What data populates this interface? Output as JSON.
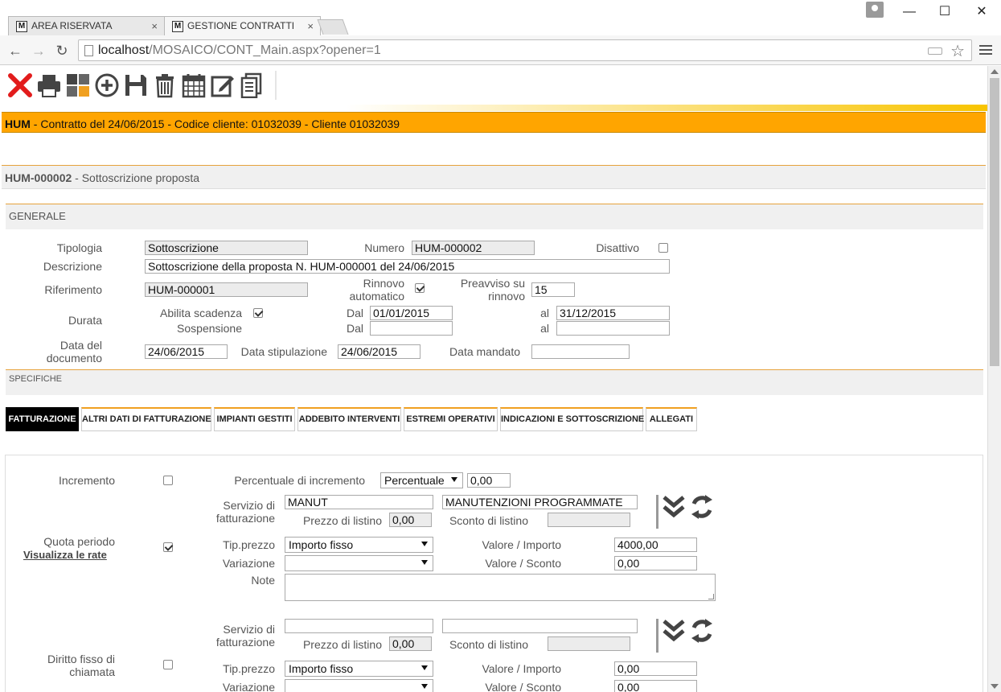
{
  "browser": {
    "tabs": [
      {
        "label": "AREA RISERVATA"
      },
      {
        "label": "GESTIONE CONTRATTI"
      }
    ],
    "url_host": "localhost",
    "url_path": "/MOSAICO/CONT_Main.aspx?opener=1",
    "tab_close": "×",
    "min": "—",
    "max": "☐",
    "close": "✕"
  },
  "toolbar": {
    "icons": [
      "close-icon",
      "print-icon",
      "puzzle-icon",
      "add-icon",
      "save-icon",
      "delete-icon",
      "calendar-icon",
      "edit-icon",
      "copy-icon"
    ]
  },
  "header": {
    "code": "HUM",
    "text": " - Contratto del 24/06/2015 - Codice cliente: 01032039 - Cliente 01032039"
  },
  "document": {
    "code": "HUM-000002",
    "text": " - Sottoscrizione proposta"
  },
  "generale": {
    "title": "GENERALE",
    "tipologia_label": "Tipologia",
    "tipologia": "Sottoscrizione",
    "numero_label": "Numero",
    "numero": "HUM-000002",
    "disattivo_label": "Disattivo",
    "descrizione_label": "Descrizione",
    "descrizione": "Sottoscrizione della proposta N. HUM-000001 del 24/06/2015",
    "riferimento_label": "Riferimento",
    "riferimento": "HUM-000001",
    "rinnovo_label_1": "Rinnovo",
    "rinnovo_label_2": "automatico",
    "preavviso_label_1": "Preavviso su",
    "preavviso_label_2": "rinnovo",
    "preavviso": "15",
    "durata_label": "Durata",
    "abilita_label": "Abilita scadenza",
    "sospensione_label": "Sospensione",
    "dal_label": "Dal",
    "al_label": "al",
    "dal1": "01/01/2015",
    "al1": "31/12/2015",
    "dal2": "",
    "al2": "",
    "data_doc_label_1": "Data del",
    "data_doc_label_2": "documento",
    "data_doc": "24/06/2015",
    "data_stip_label": "Data stipulazione",
    "data_stip": "24/06/2015",
    "data_mandato_label": "Data mandato",
    "data_mandato": ""
  },
  "specifiche": {
    "title": "SPECIFICHE",
    "tabs": [
      "FATTURAZIONE",
      "ALTRI DATI DI FATTURAZIONE",
      "IMPIANTI GESTITI",
      "ADDEBITO INTERVENTI",
      "ESTREMI OPERATIVI",
      "INDICAZIONI E SOTTOSCRIZIONE",
      "ALLEGATI"
    ]
  },
  "fatturazione": {
    "incremento_label": "Incremento",
    "perc_label": "Percentuale di incremento",
    "perc_select": "Percentuale",
    "perc_value": "0,00",
    "servizio_label_1": "Servizio di",
    "servizio_label_2": "fatturazione",
    "servizio_code": "MANUT",
    "servizio_desc": "MANUTENZIONI PROGRAMMATE",
    "prezzo_label": "Prezzo di listino",
    "prezzo": "0,00",
    "sconto_label": "Sconto di listino",
    "sconto": "",
    "quota_label": "Quota periodo",
    "visualizza_label": "Visualizza le rate",
    "tip_label": "Tip.prezzo",
    "tip_select": "Importo fisso",
    "valore_imp_label": "Valore / Importo",
    "valore_imp": "4000,00",
    "variazione_label": "Variazione",
    "variazione_select": "",
    "valore_sconto_label": "Valore / Sconto",
    "valore_sconto": "0,00",
    "note_label": "Note",
    "servizio2_code": "",
    "servizio2_desc": "",
    "prezzo2": "0,00",
    "sconto2": "",
    "diritto_label_1": "Diritto fisso di",
    "diritto_label_2": "chiamata",
    "tip2_select": "Importo fisso",
    "valore_imp2": "0,00",
    "variazione2_select": "",
    "valore_sconto2": "0,00"
  }
}
